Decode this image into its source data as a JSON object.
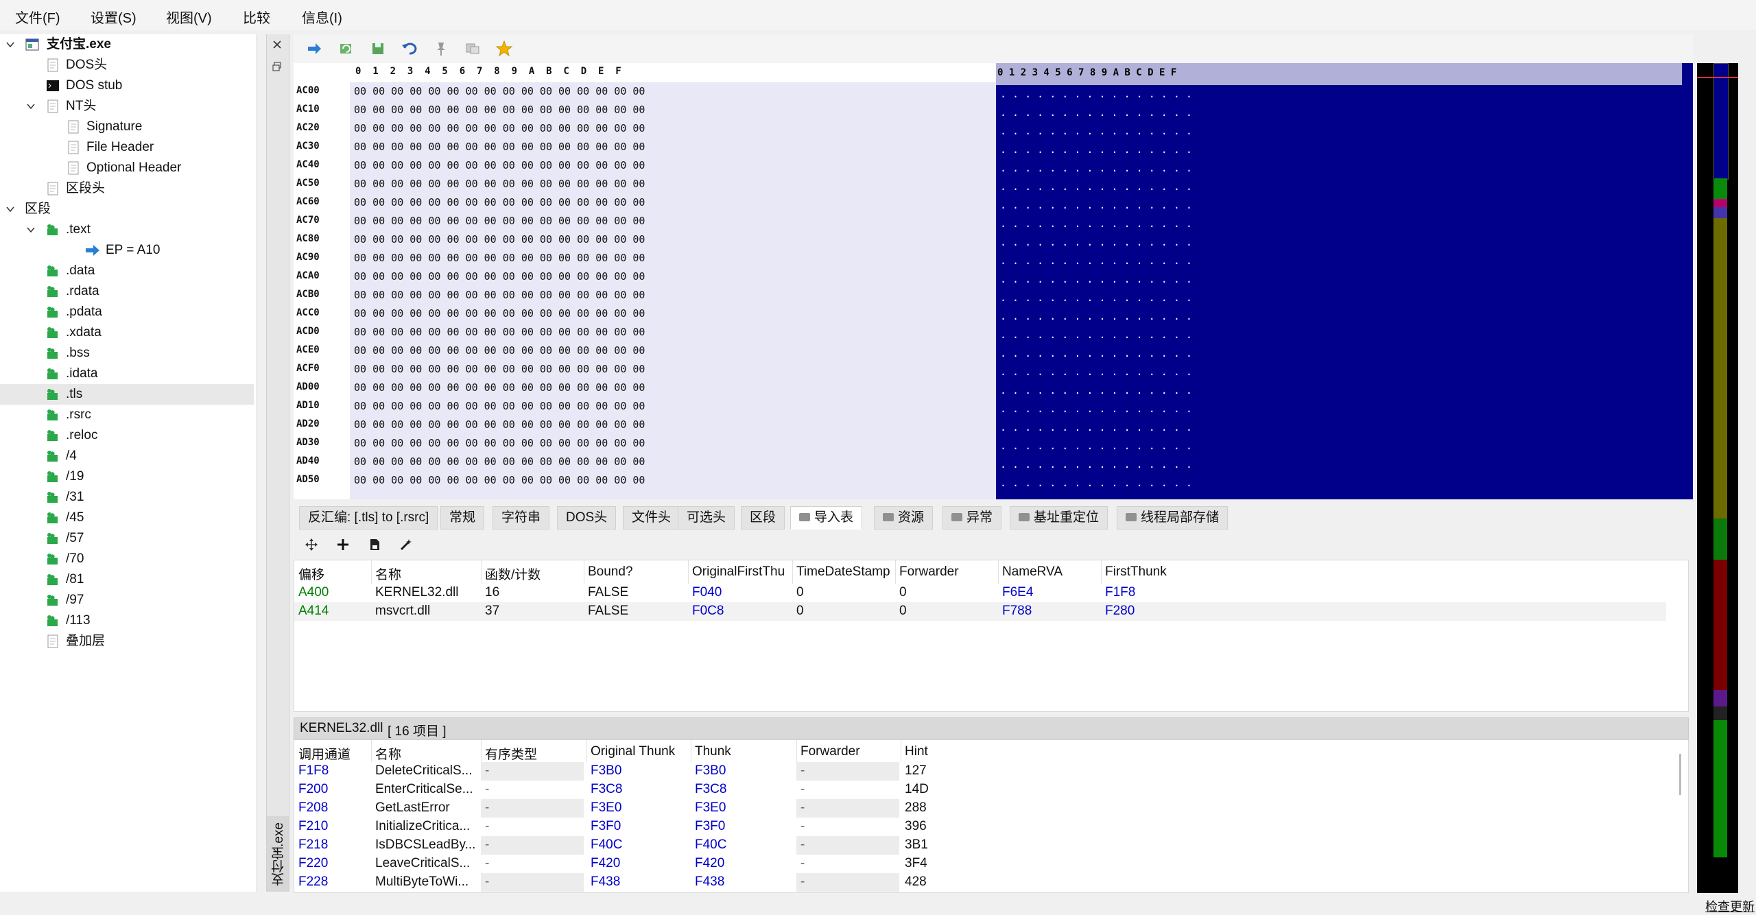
{
  "menu": [
    "文件(F)",
    "设置(S)",
    "视图(V)",
    "比较",
    "信息(I)"
  ],
  "tree": {
    "root": "支付宝.exe",
    "items": [
      "DOS头",
      "DOS stub",
      "NT头",
      "Signature",
      "File Header",
      "Optional Header",
      "区段头",
      "区段",
      ".text",
      "EP = A10",
      ".data",
      ".rdata",
      ".pdata",
      ".xdata",
      ".bss",
      ".idata",
      ".tls",
      ".rsrc",
      ".reloc",
      "/4",
      "/19",
      "/31",
      "/45",
      "/57",
      "/70",
      "/81",
      "/97",
      "/113",
      "叠加层"
    ],
    "selected": ".tls"
  },
  "vertical_tab": "支付宝.exe",
  "toolbar_icons": [
    "go-arrow-icon",
    "refresh-icon",
    "save-icon",
    "undo-icon",
    "pin-icon",
    "copy-icon",
    "star-icon"
  ],
  "hex": {
    "header": "0  1  2  3  4  5  6  7  8  9  A  B  C  D  E  F",
    "text_header": "0 1 2 3 4 5 6 7 8 9 A B C D E F",
    "addresses": [
      "AC00",
      "AC10",
      "AC20",
      "AC30",
      "AC40",
      "AC50",
      "AC60",
      "AC70",
      "AC80",
      "AC90",
      "ACA0",
      "ACB0",
      "ACC0",
      "ACD0",
      "ACE0",
      "ACF0",
      "AD00",
      "AD10",
      "AD20",
      "AD30",
      "AD40",
      "AD50"
    ],
    "row_bytes": "00 00 00 00 00 00 00 00 00 00 00 00 00 00 00 00",
    "row_text": ". . . . . . . . . . . . . . . ."
  },
  "tabs": [
    "反汇编: [.tls] to [.rsrc]",
    "常规",
    "字符串",
    "DOS头",
    "文件头",
    "可选头",
    "区段",
    "导入表",
    "资源",
    "异常",
    "基址重定位",
    "线程局部存储"
  ],
  "active_tab": "导入表",
  "import_table": {
    "columns": [
      "偏移",
      "名称",
      "函数/计数",
      "Bound?",
      "OriginalFirstThu",
      "TimeDateStamp",
      "Forwarder",
      "NameRVA",
      "FirstThunk"
    ],
    "rows": [
      [
        "A400",
        "KERNEL32.dll",
        "16",
        "FALSE",
        "F040",
        "0",
        "0",
        "F6E4",
        "F1F8"
      ],
      [
        "A414",
        "msvcrt.dll",
        "37",
        "FALSE",
        "F0C8",
        "0",
        "0",
        "F788",
        "F280"
      ]
    ]
  },
  "kernel_bar": {
    "dll": "KERNEL32.dll",
    "count": "[ 16 项目 ]"
  },
  "functions": {
    "columns": [
      "调用通道",
      "名称",
      "有序类型",
      "Original Thunk",
      "Thunk",
      "Forwarder",
      "Hint"
    ],
    "rows": [
      [
        "F1F8",
        "DeleteCriticalS...",
        "-",
        "F3B0",
        "F3B0",
        "-",
        "127"
      ],
      [
        "F200",
        "EnterCriticalSe...",
        "-",
        "F3C8",
        "F3C8",
        "-",
        "14D"
      ],
      [
        "F208",
        "GetLastError",
        "-",
        "F3E0",
        "F3E0",
        "-",
        "288"
      ],
      [
        "F210",
        "InitializeCritica...",
        "-",
        "F3F0",
        "F3F0",
        "-",
        "396"
      ],
      [
        "F218",
        "IsDBCSLeadBy...",
        "-",
        "F40C",
        "F40C",
        "-",
        "3B1"
      ],
      [
        "F220",
        "LeaveCriticalS...",
        "-",
        "F420",
        "F420",
        "-",
        "3F4"
      ],
      [
        "F228",
        "MultiByteToWi...",
        "-",
        "F438",
        "F438",
        "-",
        "428"
      ]
    ]
  },
  "status": "检查更新",
  "colors": {
    "hex_bg": "#e8e8f6",
    "text_bg": "#00008b",
    "link": "#0000cc",
    "offset": "#008000"
  }
}
